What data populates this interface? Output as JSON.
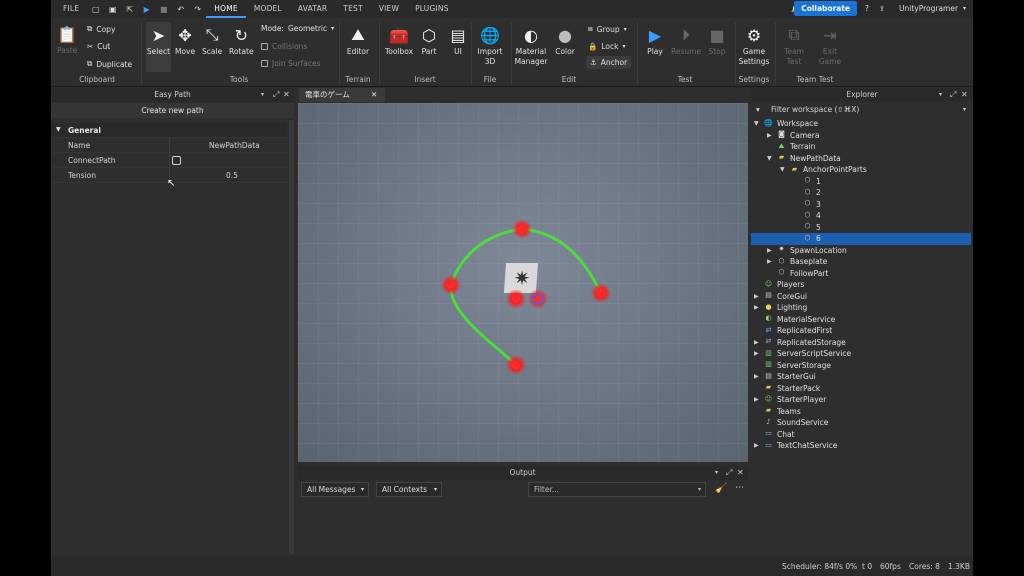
{
  "menubar": {
    "file": "FILE",
    "tabs": [
      "HOME",
      "MODEL",
      "AVATAR",
      "TEST",
      "VIEW",
      "PLUGINS"
    ],
    "collaborate": "Collaborate",
    "user": "UnityProgramer"
  },
  "ribbon": {
    "clipboard": {
      "paste": "Paste",
      "copy": "Copy",
      "cut": "Cut",
      "duplicate": "Duplicate",
      "label": "Clipboard"
    },
    "tools": {
      "select": "Select",
      "move": "Move",
      "scale": "Scale",
      "rotate": "Rotate",
      "mode_label": "Mode:",
      "mode_value": "Geometric",
      "collisions": "Collisions",
      "join_surfaces": "Join Surfaces",
      "label": "Tools"
    },
    "terrain": {
      "editor": "Editor",
      "label": "Terrain"
    },
    "insert": {
      "toolbox": "Toolbox",
      "part": "Part",
      "ui": "UI",
      "label": "Insert"
    },
    "file": {
      "import3d": "Import 3D",
      "label": "File"
    },
    "edit": {
      "material": "Material Manager",
      "color": "Color",
      "group": "Group",
      "lock": "Lock",
      "anchor": "Anchor",
      "label": "Edit"
    },
    "test": {
      "play": "Play",
      "resume": "Resume",
      "stop": "Stop",
      "label": "Test"
    },
    "settings": {
      "game": "Game Settings",
      "label": "Settings"
    },
    "team_test": {
      "team": "Team Test",
      "exit": "Exit Game",
      "label": "Team Test"
    }
  },
  "easy_path": {
    "title": "Easy Path",
    "create_button": "Create new path",
    "section": "General",
    "props": [
      {
        "name": "Name",
        "value": "NewPathData"
      },
      {
        "name": "ConnectPath",
        "value": ""
      },
      {
        "name": "Tension",
        "value": "0.5"
      }
    ]
  },
  "viewport": {
    "tab_title": "電車のゲーム"
  },
  "output": {
    "title": "Output",
    "messages_filter": "All Messages",
    "contexts_filter": "All Contexts",
    "search_placeholder": "Filter..."
  },
  "explorer": {
    "title": "Explorer",
    "filter_placeholder": "Filter workspace (⇧⌘X)",
    "items": [
      {
        "label": "Workspace",
        "depth": 0,
        "expand": "open",
        "icon": "globe"
      },
      {
        "label": "Camera",
        "depth": 1,
        "expand": "closed",
        "icon": "camera"
      },
      {
        "label": "Terrain",
        "depth": 1,
        "expand": "",
        "icon": "terrain"
      },
      {
        "label": "NewPathData",
        "depth": 1,
        "expand": "open",
        "icon": "folder"
      },
      {
        "label": "AnchorPointParts",
        "depth": 2,
        "expand": "open",
        "icon": "folder"
      },
      {
        "label": "1",
        "depth": 3,
        "expand": "",
        "icon": "part"
      },
      {
        "label": "2",
        "depth": 3,
        "expand": "",
        "icon": "part"
      },
      {
        "label": "3",
        "depth": 3,
        "expand": "",
        "icon": "part"
      },
      {
        "label": "4",
        "depth": 3,
        "expand": "",
        "icon": "part"
      },
      {
        "label": "5",
        "depth": 3,
        "expand": "",
        "icon": "part"
      },
      {
        "label": "6",
        "depth": 3,
        "expand": "",
        "icon": "part",
        "selected": true
      },
      {
        "label": "SpawnLocation",
        "depth": 1,
        "expand": "closed",
        "icon": "spawn"
      },
      {
        "label": "Baseplate",
        "depth": 1,
        "expand": "closed",
        "icon": "part"
      },
      {
        "label": "FollowPart",
        "depth": 1,
        "expand": "",
        "icon": "part"
      },
      {
        "label": "Players",
        "depth": 0,
        "expand": "",
        "icon": "players"
      },
      {
        "label": "CoreGui",
        "depth": 0,
        "expand": "closed",
        "icon": "gui"
      },
      {
        "label": "Lighting",
        "depth": 0,
        "expand": "closed",
        "icon": "bulb"
      },
      {
        "label": "MaterialService",
        "depth": 0,
        "expand": "",
        "icon": "material"
      },
      {
        "label": "ReplicatedFirst",
        "depth": 0,
        "expand": "",
        "icon": "repl"
      },
      {
        "label": "ReplicatedStorage",
        "depth": 0,
        "expand": "closed",
        "icon": "repl"
      },
      {
        "label": "ServerScriptService",
        "depth": 0,
        "expand": "closed",
        "icon": "server"
      },
      {
        "label": "ServerStorage",
        "depth": 0,
        "expand": "",
        "icon": "server"
      },
      {
        "label": "StarterGui",
        "depth": 0,
        "expand": "closed",
        "icon": "gui"
      },
      {
        "label": "StarterPack",
        "depth": 0,
        "expand": "",
        "icon": "folder"
      },
      {
        "label": "StarterPlayer",
        "depth": 0,
        "expand": "closed",
        "icon": "players"
      },
      {
        "label": "Teams",
        "depth": 0,
        "expand": "",
        "icon": "teams"
      },
      {
        "label": "SoundService",
        "depth": 0,
        "expand": "",
        "icon": "sound"
      },
      {
        "label": "Chat",
        "depth": 0,
        "expand": "",
        "icon": "chat"
      },
      {
        "label": "TextChatService",
        "depth": 0,
        "expand": "closed",
        "icon": "chat"
      }
    ]
  },
  "status": {
    "scheduler": "Scheduler: 84f/s 0%",
    "t": "t 0",
    "fps": "60fps",
    "cores": "Cores: 8",
    "mem": "1.3KB"
  },
  "colors": {
    "accent": "#1a73d9",
    "selection": "#1c5fb0",
    "path": "#4cdc3c",
    "anchor": "#ff2a2a"
  }
}
